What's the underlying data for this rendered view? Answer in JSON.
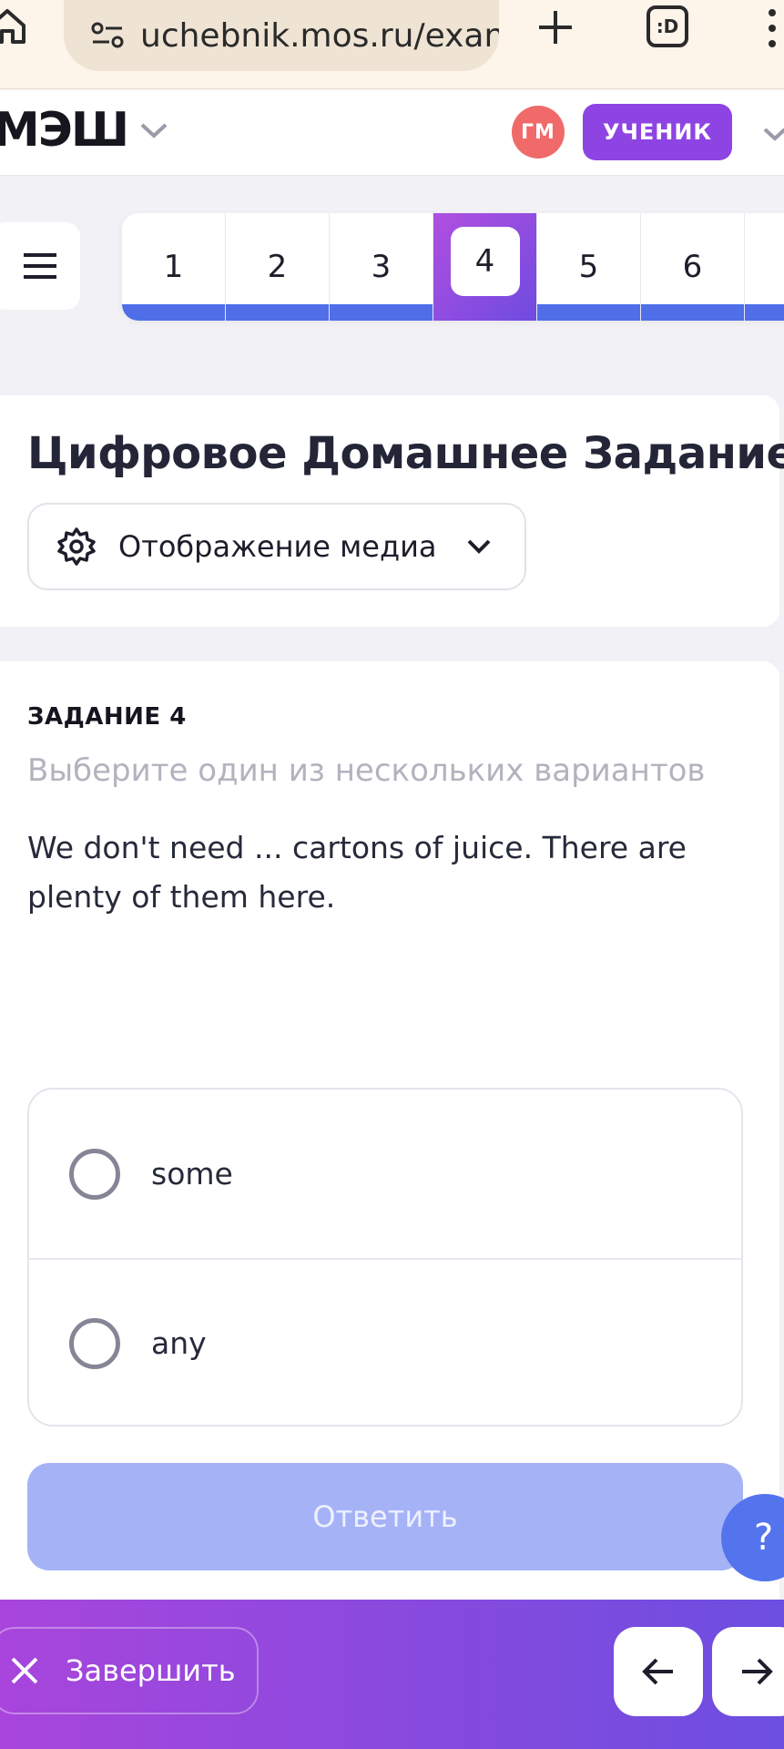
{
  "browser": {
    "url": "uchebnik.mos.ru/exan",
    "tab_count_label": ":D"
  },
  "header": {
    "logo": "МЭШ",
    "avatar_initials": "ГМ",
    "role": "УЧЕНИК"
  },
  "question_nav": {
    "items": [
      "1",
      "2",
      "3",
      "4",
      "5",
      "6"
    ],
    "active": "4"
  },
  "title_card": {
    "title": "Цифровое Домашнее Задание",
    "media_button": "Отображение медиа"
  },
  "task": {
    "number": "ЗАДАНИЕ 4",
    "hint": "Выберите один из нескольких вариантов",
    "text": "We don't need ... cartons of juice. There are plenty of them here.",
    "options": [
      "some",
      "any"
    ],
    "submit_label": "Ответить"
  },
  "help_label": "?",
  "footer": {
    "finish_label": "Завершить"
  },
  "colors": {
    "accent_blue": "#4f6ee8",
    "accent_purple": "#8e44e3",
    "avatar_red": "#f06a6a",
    "submit_disabled": "#a5b3f6"
  },
  "icons": [
    "home-icon",
    "site-settings-icon",
    "plus-icon",
    "tabs-icon",
    "more-icon",
    "chevron-down-icon",
    "burger-icon",
    "gear-icon",
    "close-icon",
    "arrow-left-icon",
    "arrow-right-icon"
  ]
}
